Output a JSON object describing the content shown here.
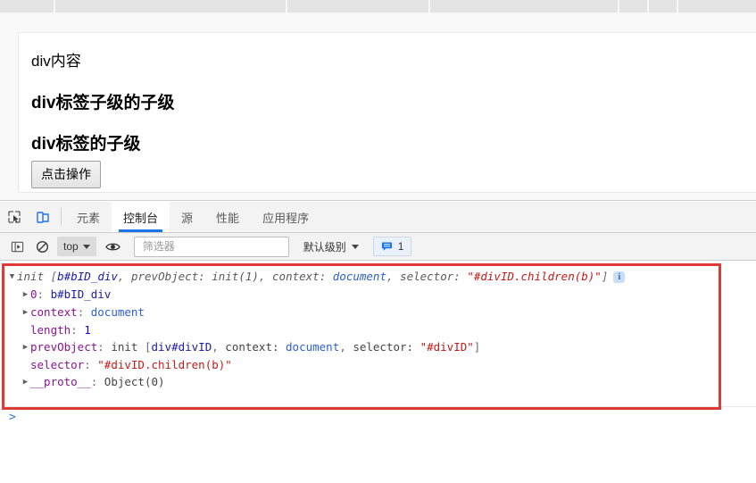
{
  "browser_strip": {
    "dividers": [
      60,
      320,
      480,
      692,
      725,
      758
    ]
  },
  "page": {
    "div_content": "div内容",
    "heading_grandchild": "div标签子级的子级",
    "heading_child": "div标签的子级",
    "button_label": "点击操作"
  },
  "devtools": {
    "icons": {
      "inspect": "inspect-cursor-icon",
      "device": "device-toolbar-icon"
    },
    "tabs": [
      {
        "label": "元素",
        "active": false
      },
      {
        "label": "控制台",
        "active": true
      },
      {
        "label": "源",
        "active": false
      },
      {
        "label": "性能",
        "active": false
      },
      {
        "label": "应用程序",
        "active": false
      }
    ],
    "active_tab_underline_color": "#1a73e8",
    "toolbar": {
      "sidebar_toggle": "console-sidebar-icon",
      "clear_label": "clear-console-icon",
      "context_value": "top",
      "eye_label": "live-expression-icon",
      "filter_placeholder": "筛选器",
      "filter_value": "",
      "level_label": "默认级别",
      "message_count": "1",
      "message_badge_icon": "message-icon"
    },
    "console": {
      "lines": [
        {
          "id": "line-root",
          "indent": 0,
          "triangle": "open",
          "tokens": [
            {
              "t": "init ",
              "c": "tok-name tok-italic"
            },
            {
              "t": "[",
              "c": "tok-punc tok-italic"
            },
            {
              "t": "b#bID_div",
              "c": "tok-node tok-italic"
            },
            {
              "t": ", ",
              "c": "tok-punc tok-italic"
            },
            {
              "t": "prevObject: ",
              "c": "tok-name tok-italic"
            },
            {
              "t": "init(1)",
              "c": "tok-name tok-italic"
            },
            {
              "t": ", ",
              "c": "tok-punc tok-italic"
            },
            {
              "t": "context: ",
              "c": "tok-name tok-italic"
            },
            {
              "t": "document",
              "c": "tok-blue tok-italic"
            },
            {
              "t": ", ",
              "c": "tok-punc tok-italic"
            },
            {
              "t": "selector: ",
              "c": "tok-name tok-italic"
            },
            {
              "t": "\"#divID.children(b)\"",
              "c": "tok-str tok-italic"
            },
            {
              "t": "]",
              "c": "tok-punc tok-italic"
            }
          ],
          "info_icon": true
        },
        {
          "id": "line-0",
          "indent": 1,
          "triangle": "closed",
          "tokens": [
            {
              "t": "0",
              "c": "tok-key"
            },
            {
              "t": ": ",
              "c": "tok-punc"
            },
            {
              "t": "b#bID_div",
              "c": "tok-node"
            }
          ],
          "info_icon": false
        },
        {
          "id": "line-context",
          "indent": 1,
          "triangle": "closed",
          "tokens": [
            {
              "t": "context",
              "c": "tok-key"
            },
            {
              "t": ": ",
              "c": "tok-punc"
            },
            {
              "t": "document",
              "c": "tok-blue"
            }
          ],
          "info_icon": false
        },
        {
          "id": "line-length",
          "indent": 1,
          "triangle": "none",
          "tokens": [
            {
              "t": "length",
              "c": "tok-key"
            },
            {
              "t": ": ",
              "c": "tok-punc"
            },
            {
              "t": "1",
              "c": "tok-num"
            }
          ],
          "info_icon": false
        },
        {
          "id": "line-prevobject",
          "indent": 1,
          "triangle": "closed",
          "tokens": [
            {
              "t": "prevObject",
              "c": "tok-key"
            },
            {
              "t": ": ",
              "c": "tok-punc"
            },
            {
              "t": "init ",
              "c": "tok-plain"
            },
            {
              "t": "[",
              "c": "tok-punc"
            },
            {
              "t": "div#divID",
              "c": "tok-node"
            },
            {
              "t": ", ",
              "c": "tok-punc"
            },
            {
              "t": "context: ",
              "c": "tok-plain"
            },
            {
              "t": "document",
              "c": "tok-blue"
            },
            {
              "t": ", ",
              "c": "tok-punc"
            },
            {
              "t": "selector: ",
              "c": "tok-plain"
            },
            {
              "t": "\"#divID\"",
              "c": "tok-str"
            },
            {
              "t": "]",
              "c": "tok-punc"
            }
          ],
          "info_icon": false
        },
        {
          "id": "line-selector",
          "indent": 1,
          "triangle": "none",
          "tokens": [
            {
              "t": "selector",
              "c": "tok-key"
            },
            {
              "t": ": ",
              "c": "tok-punc"
            },
            {
              "t": "\"#divID.children(b)\"",
              "c": "tok-str"
            }
          ],
          "info_icon": false
        },
        {
          "id": "line-proto",
          "indent": 1,
          "triangle": "closed",
          "tokens": [
            {
              "t": "__proto__",
              "c": "tok-key"
            },
            {
              "t": ": ",
              "c": "tok-punc"
            },
            {
              "t": "Object(0)",
              "c": "tok-plain"
            }
          ],
          "info_icon": false
        }
      ],
      "prompt": ">",
      "highlight_border_color": "#e03a34"
    }
  }
}
